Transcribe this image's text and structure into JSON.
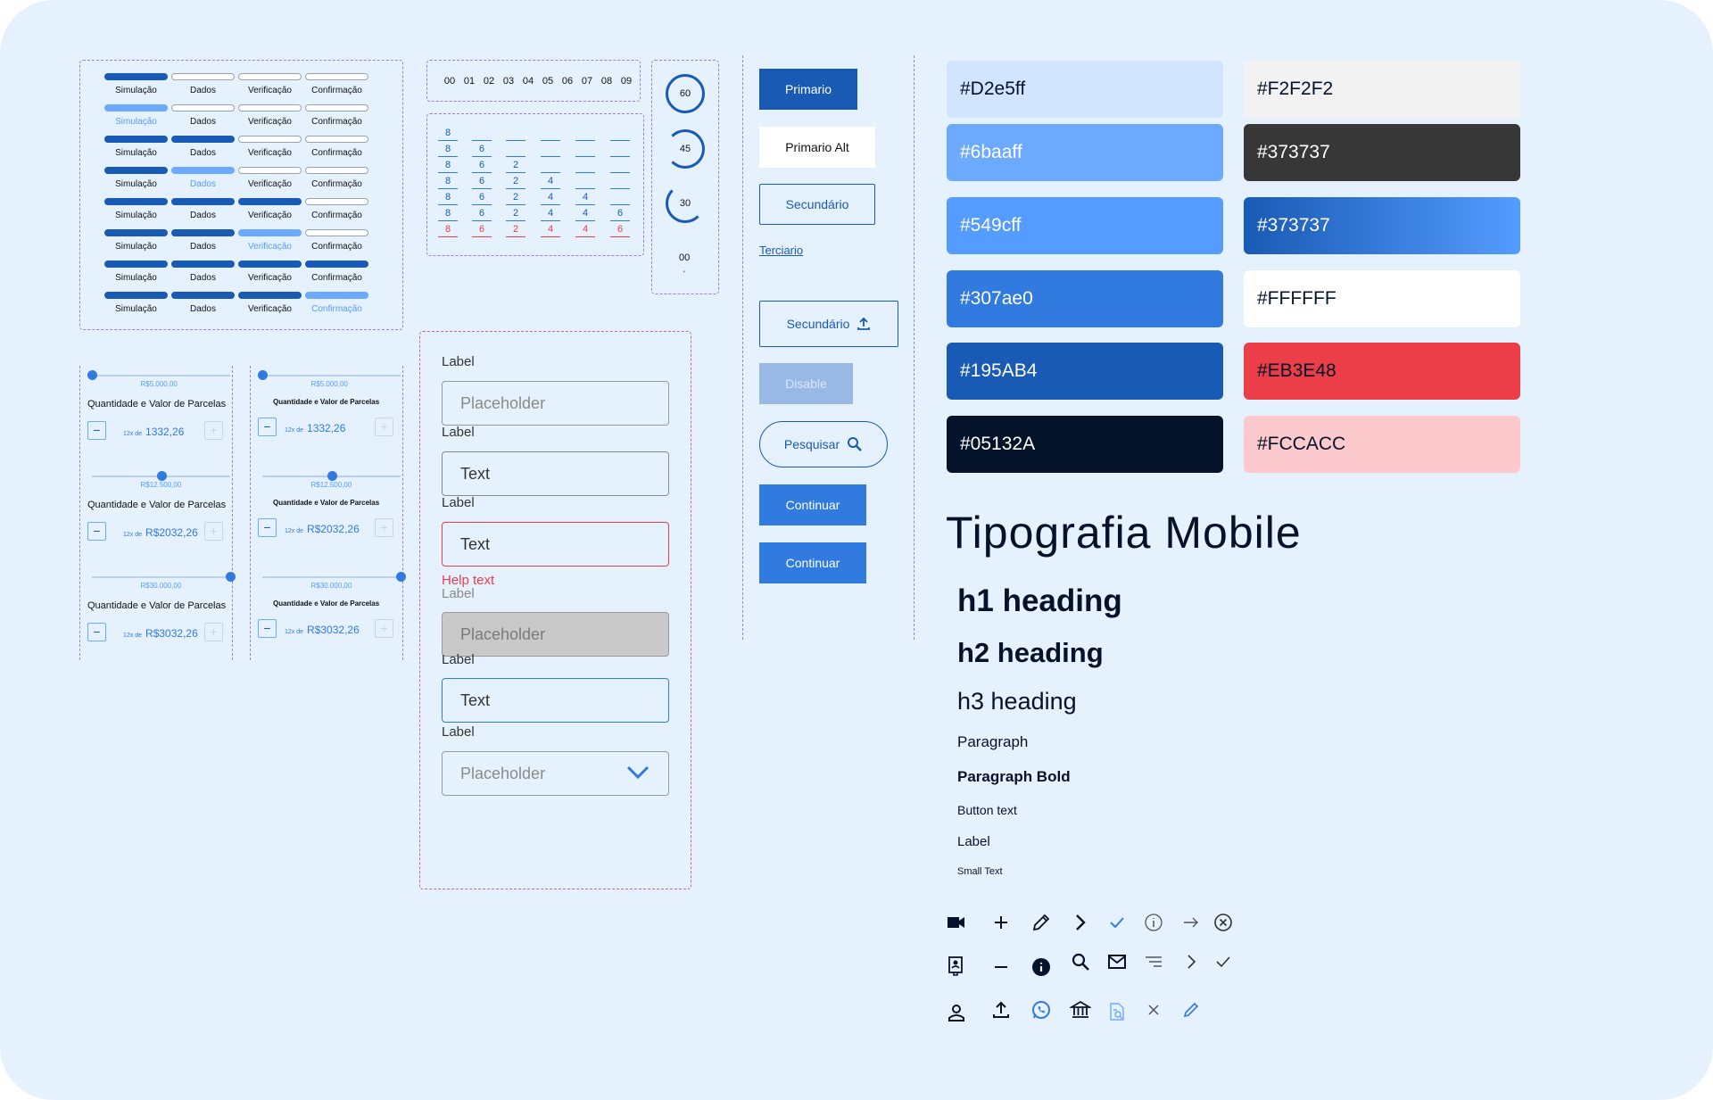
{
  "stepper": {
    "steps": [
      "Simulação",
      "Dados",
      "Verificação",
      "Confirmação"
    ]
  },
  "digits": {
    "row": [
      "00",
      "01",
      "02",
      "03",
      "04",
      "05",
      "06",
      "07",
      "08",
      "09"
    ],
    "columns": [
      [
        "8",
        "8",
        "8",
        "8",
        "8",
        "8",
        "8"
      ],
      [
        "6",
        "6",
        "6",
        "6",
        "6",
        "6"
      ],
      [
        "2",
        "2",
        "2",
        "2",
        "2"
      ],
      [
        "4",
        "4",
        "4",
        "4"
      ],
      [
        "4",
        "4",
        "4"
      ],
      [
        "6",
        "6"
      ]
    ]
  },
  "timer": {
    "values": [
      "60",
      "45",
      "30"
    ],
    "final": "00",
    "final_mark": "'"
  },
  "sliders": {
    "title": "Quantidade e Valor de Parcelas",
    "prefix": "12x de",
    "items": [
      {
        "value": "R$5.000,00",
        "amount": "1332,26",
        "level": 0.0
      },
      {
        "value": "R$12.500,00",
        "amount": "R$2032,26",
        "level": 0.5
      },
      {
        "value": "R$30.000,00",
        "amount": "R$3032,26",
        "level": 1.0
      }
    ]
  },
  "form": {
    "label": "Label",
    "fields": [
      {
        "value": "Placeholder",
        "state": "default"
      },
      {
        "value": "Text",
        "state": "filled"
      },
      {
        "value": "Text",
        "state": "error"
      },
      {
        "value": "Placeholder",
        "state": "disabled"
      },
      {
        "value": "Text",
        "state": "focus"
      },
      {
        "value": "Placeholder",
        "state": "select"
      }
    ],
    "help_text": "Help text"
  },
  "buttons": {
    "primary": "Primario",
    "primary_alt": "Primario Alt",
    "secondary": "Secundário",
    "tertiary": "Terciario",
    "secondary_upload": "Secundário",
    "disabled": "Disable",
    "search": "Pesquisar",
    "continue1": "Continuar",
    "continue2": "Continuar"
  },
  "colors": {
    "left": [
      {
        "label": "#D2e5ff",
        "hex": "#D2E5FF",
        "text": "#05132A"
      },
      {
        "label": "#6baaff",
        "hex": "#6BAAFF",
        "text": "#FFFFFF"
      },
      {
        "label": "#549cff",
        "hex": "#549CFF",
        "text": "#FFFFFF"
      },
      {
        "label": "#307ae0",
        "hex": "#307AE0",
        "text": "#FFFFFF"
      },
      {
        "label": "#195AB4",
        "hex": "#195AB4",
        "text": "#FFFFFF"
      },
      {
        "label": "#05132A",
        "hex": "#05132A",
        "text": "#FFFFFF"
      }
    ],
    "right": [
      {
        "label": "#F2F2F2",
        "hex": "#F2F2F2",
        "text": "#05132A"
      },
      {
        "label": "#373737",
        "hex": "#373737",
        "text": "#FFFFFF"
      },
      {
        "label": "#373737",
        "hex": "linear-gradient(90deg,#195AB4,#549CFF)",
        "text": "#FFFFFF"
      },
      {
        "label": "#FFFFFF",
        "hex": "#FFFFFF",
        "text": "#05132A"
      },
      {
        "label": "#EB3E48",
        "hex": "#EB3E48",
        "text": "#05132A"
      },
      {
        "label": "#FCCACC",
        "hex": "#FCCACC",
        "text": "#05132A"
      }
    ]
  },
  "typography": {
    "title": "Tipografia Mobile",
    "h1": "h1 heading",
    "h2": "h2 heading",
    "h3": "h3 heading",
    "paragraph": "Paragraph",
    "paragraph_bold": "Paragraph Bold",
    "button_text": "Button text",
    "label": "Label",
    "small_text": "Small Text"
  },
  "icons": [
    "video-icon",
    "plus-icon",
    "pencil-icon",
    "chevron-right-icon",
    "check-icon",
    "info-outline-icon",
    "arrow-right-icon",
    "close-circle-icon",
    "contact-card-icon",
    "minus-icon",
    "info-filled-icon",
    "search-icon",
    "mail-icon",
    "filter-icon",
    "chevron-right-thin-icon",
    "check-thin-icon",
    "user-icon",
    "upload-icon",
    "whatsapp-icon",
    "bank-icon",
    "document-search-icon",
    "close-icon",
    "edit-icon"
  ]
}
